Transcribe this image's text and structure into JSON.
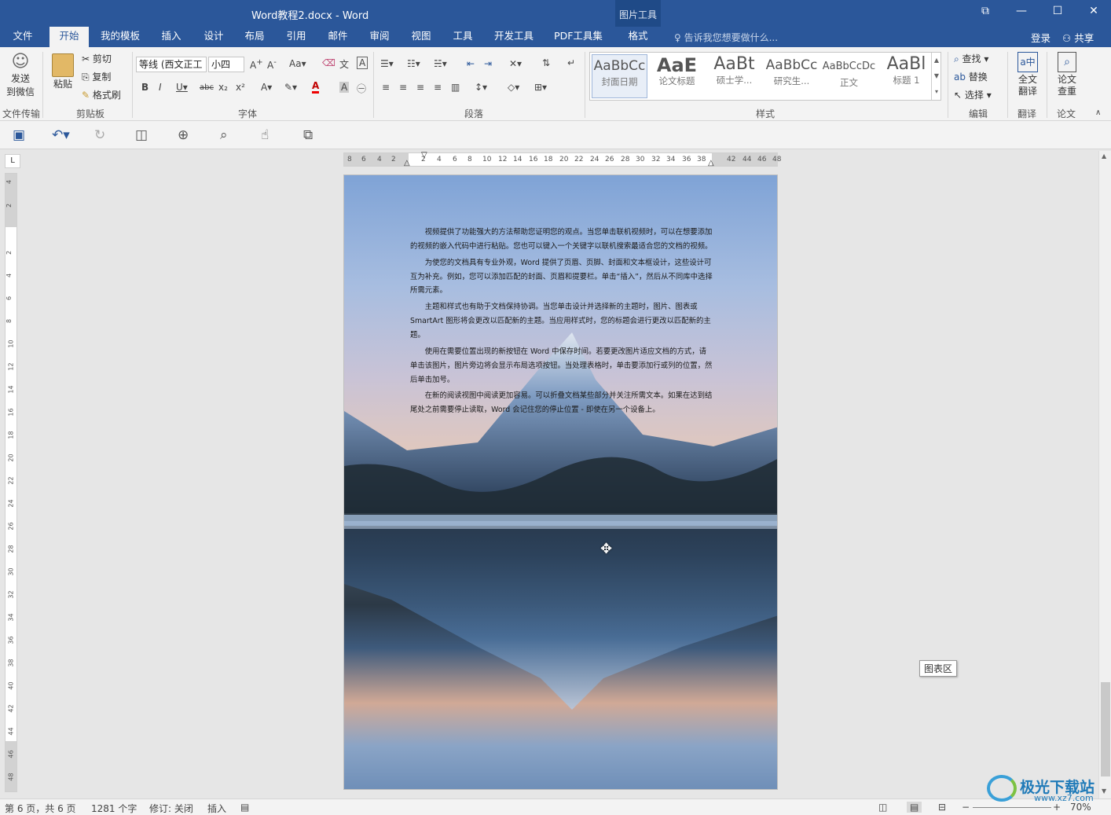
{
  "window": {
    "title": "Word教程2.docx - Word",
    "context_group": "图片工具",
    "controls": [
      "⧉",
      "—",
      "☐",
      "✕"
    ]
  },
  "tabs": [
    "文件",
    "开始",
    "我的模板",
    "插入",
    "设计",
    "布局",
    "引用",
    "邮件",
    "审阅",
    "视图",
    "工具",
    "开发工具",
    "PDF工具集",
    "格式"
  ],
  "active_tab": "开始",
  "tell_me": "告诉我您想要做什么...",
  "signin": "登录",
  "share": "共享",
  "ribbon": {
    "send_wechat": {
      "line1": "发送",
      "line2": "到微信",
      "group": "文件传输"
    },
    "clipboard": {
      "paste": "粘贴",
      "cut": "剪切",
      "copy": "复制",
      "format_painter": "格式刷",
      "group": "剪贴板"
    },
    "font": {
      "name": "等线 (西文正文)",
      "name_shown": "等线 (西文正工",
      "size": "小四",
      "group": "字体"
    },
    "paragraph": {
      "group": "段落"
    },
    "styles": {
      "group": "样式",
      "items": [
        {
          "sample": "AaBbCc",
          "name": "封面日期"
        },
        {
          "sample": "AaE",
          "name": "论文标题"
        },
        {
          "sample": "AaBt",
          "name": "硕士学..."
        },
        {
          "sample": "AaBbCc",
          "name": "研究生..."
        },
        {
          "sample": "AaBbCcDc",
          "name": "正文"
        },
        {
          "sample": "AaBl",
          "name": "标题 1"
        }
      ]
    },
    "editing": {
      "find": "查找",
      "replace": "替换",
      "select": "选择",
      "group": "编辑"
    },
    "translate": {
      "label1": "全文",
      "label2": "翻译",
      "group": "翻译"
    },
    "paper": {
      "label1": "论文",
      "label2": "查重",
      "group": "论文"
    }
  },
  "ruler": {
    "h_numbers": [
      "8",
      "6",
      "4",
      "2",
      "2",
      "4",
      "6",
      "8",
      "10",
      "12",
      "14",
      "16",
      "18",
      "20",
      "22",
      "24",
      "26",
      "28",
      "30",
      "32",
      "34",
      "36",
      "38",
      "42",
      "44",
      "46",
      "48"
    ],
    "v_numbers": [
      "4",
      "2",
      "2",
      "4",
      "6",
      "8",
      "10",
      "12",
      "14",
      "16",
      "18",
      "20",
      "22",
      "24",
      "26",
      "28",
      "30",
      "32",
      "34",
      "36",
      "38",
      "40",
      "42",
      "44",
      "46",
      "48"
    ],
    "corner": "L"
  },
  "document": {
    "paragraphs": [
      "视频提供了功能强大的方法帮助您证明您的观点。当您单击联机视频时，可以在想要添加的视频的嵌入代码中进行粘贴。您也可以键入一个关键字以联机搜索最适合您的文档的视频。",
      "为使您的文档具有专业外观，Word 提供了页眉、页脚、封面和文本框设计，这些设计可互为补充。例如，您可以添加匹配的封面、页眉和提要栏。单击“插入”，然后从不同库中选择所需元素。",
      "主题和样式也有助于文档保持协调。当您单击设计并选择新的主题时，图片、图表或 SmartArt 图形将会更改以匹配新的主题。当应用样式时，您的标题会进行更改以匹配新的主题。",
      "使用在需要位置出现的新按钮在 Word 中保存时间。若要更改图片适应文档的方式，请单击该图片，图片旁边将会显示布局选项按钮。当处理表格时，单击要添加行或列的位置，然后单击加号。",
      "在新的阅读视图中阅读更加容易。可以折叠文档某些部分并关注所需文本。如果在达到结尾处之前需要停止读取，Word 会记住您的停止位置 - 即使在另一个设备上。"
    ]
  },
  "chart_area_tooltip": "图表区",
  "status": {
    "page": "第 6 页，共 6 页",
    "words": "1281 个字",
    "track": "修订: 关闭",
    "insert": "插入",
    "zoom": "70%"
  },
  "watermark": {
    "text": "极光下载站",
    "url": "www.xz7.com"
  }
}
